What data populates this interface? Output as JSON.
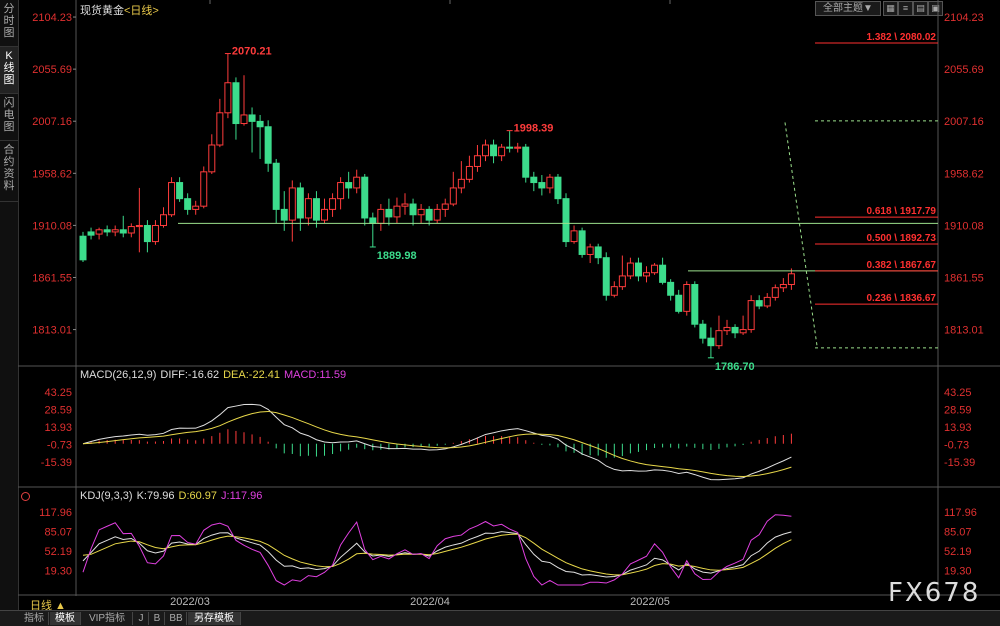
{
  "sidebar": {
    "tabs": [
      {
        "label": "分时图",
        "active": false
      },
      {
        "label": "K线图",
        "active": true
      },
      {
        "label": "闪电图",
        "active": false
      },
      {
        "label": "合约资料",
        "active": false
      }
    ]
  },
  "header": {
    "title": "现货黄金",
    "period": "<日线>",
    "theme_button": "全部主题▼"
  },
  "toolbar_icons": [
    "grid-icon",
    "list-icon",
    "panel-icon",
    "window-icon"
  ],
  "price_axis": {
    "ticks": [
      "2104.23",
      "2055.69",
      "2007.16",
      "1958.62",
      "1910.08",
      "1861.55",
      "1813.01"
    ]
  },
  "annotations": {
    "high1": "2070.21",
    "high2": "1998.39",
    "low1": "1889.98",
    "low2": "1786.70"
  },
  "fib_levels": [
    {
      "label": "1.382 \\ 2080.02",
      "price": 2080.02
    },
    {
      "label": "0.618 \\ 1917.79",
      "price": 1917.79
    },
    {
      "label": "0.500 \\ 1892.73",
      "price": 1892.73
    },
    {
      "label": "0.382 \\ 1867.67",
      "price": 1867.67
    },
    {
      "label": "0.236 \\ 1836.67",
      "price": 1836.67
    }
  ],
  "macd": {
    "name": "MACD(26,12,9)",
    "diff": "DIFF:-16.62",
    "dea": "DEA:-22.41",
    "macd": "MACD:11.59",
    "ticks": [
      "43.25",
      "28.59",
      "13.93",
      "-0.73",
      "-15.39"
    ],
    "ylim": [
      -22,
      50
    ]
  },
  "kdj": {
    "name": "KDJ(9,3,3)",
    "k": "K:79.96",
    "d": "D:60.97",
    "j": "J:117.96",
    "ticks": [
      "117.96",
      "85.07",
      "52.19",
      "19.30"
    ],
    "ylim": [
      -5,
      130
    ]
  },
  "time_axis": {
    "labels": [
      "2022/03",
      "2022/04",
      "2022/05"
    ]
  },
  "period_selector": "日线 ▲",
  "bottom_tabs": [
    {
      "label": "指标",
      "active": false
    },
    {
      "label": "模板",
      "active": true
    },
    {
      "label": "VIP指标",
      "active": false
    },
    {
      "label": "J",
      "active": false
    },
    {
      "label": "B",
      "active": false
    },
    {
      "label": "BB",
      "active": false
    },
    {
      "label": "另存模板",
      "active": true
    }
  ],
  "watermark": "FX678",
  "colors": {
    "up": "#ff3c3c",
    "down": "#3cdc8c",
    "fib": "#ff3030",
    "support": "#9be08c",
    "diff": "#e0e0e0",
    "dea": "#e8d84a",
    "j": "#e040e0"
  },
  "chart_data": {
    "type": "candlestick",
    "ylim": [
      1780,
      2108
    ],
    "candles": [
      [
        1900,
        1878,
        1904,
        1876
      ],
      [
        1904,
        1901,
        1908,
        1897
      ],
      [
        1902,
        1906,
        1908,
        1897
      ],
      [
        1906,
        1904,
        1910,
        1900
      ],
      [
        1904,
        1906,
        1910,
        1900
      ],
      [
        1906,
        1903,
        1919,
        1899
      ],
      [
        1903,
        1909,
        1912,
        1899
      ],
      [
        1909,
        1910,
        1945,
        1885
      ],
      [
        1910,
        1895,
        1915,
        1885
      ],
      [
        1895,
        1910,
        1915,
        1892
      ],
      [
        1910,
        1920,
        1927,
        1908
      ],
      [
        1920,
        1950,
        1955,
        1918
      ],
      [
        1950,
        1935,
        1955,
        1932
      ],
      [
        1935,
        1925,
        1940,
        1920
      ],
      [
        1925,
        1928,
        1933,
        1920
      ],
      [
        1928,
        1960,
        1965,
        1926
      ],
      [
        1960,
        1985,
        1995,
        1958
      ],
      [
        1985,
        2015,
        2028,
        1983
      ],
      [
        2015,
        2043,
        2070,
        2010
      ],
      [
        2043,
        2005,
        2048,
        1990
      ],
      [
        2005,
        2013,
        2050,
        2003
      ],
      [
        2013,
        2007,
        2020,
        1978
      ],
      [
        2007,
        2002,
        2013,
        1972
      ],
      [
        2002,
        1968,
        2008,
        1960
      ],
      [
        1968,
        1925,
        1972,
        1912
      ],
      [
        1925,
        1915,
        1942,
        1905
      ],
      [
        1915,
        1945,
        1952,
        1895
      ],
      [
        1945,
        1917,
        1950,
        1905
      ],
      [
        1917,
        1935,
        1940,
        1910
      ],
      [
        1935,
        1915,
        1942,
        1908
      ],
      [
        1915,
        1925,
        1935,
        1912
      ],
      [
        1925,
        1935,
        1940,
        1918
      ],
      [
        1935,
        1950,
        1955,
        1925
      ],
      [
        1950,
        1945,
        1960,
        1935
      ],
      [
        1945,
        1955,
        1962,
        1940
      ],
      [
        1955,
        1917,
        1958,
        1910
      ],
      [
        1917,
        1912,
        1922,
        1890
      ],
      [
        1912,
        1925,
        1930,
        1905
      ],
      [
        1925,
        1918,
        1935,
        1910
      ],
      [
        1918,
        1928,
        1936,
        1912
      ],
      [
        1928,
        1930,
        1940,
        1920
      ],
      [
        1930,
        1920,
        1935,
        1910
      ],
      [
        1920,
        1925,
        1930,
        1912
      ],
      [
        1925,
        1915,
        1928,
        1910
      ],
      [
        1915,
        1925,
        1930,
        1912
      ],
      [
        1925,
        1930,
        1935,
        1918
      ],
      [
        1930,
        1945,
        1960,
        1928
      ],
      [
        1945,
        1953,
        1970,
        1940
      ],
      [
        1953,
        1965,
        1975,
        1950
      ],
      [
        1965,
        1975,
        1985,
        1960
      ],
      [
        1975,
        1985,
        1990,
        1970
      ],
      [
        1985,
        1975,
        1990,
        1968
      ],
      [
        1975,
        1983,
        1986,
        1970
      ],
      [
        1983,
        1982,
        1998,
        1978
      ],
      [
        1982,
        1983,
        1987,
        1978
      ],
      [
        1983,
        1955,
        1986,
        1950
      ],
      [
        1955,
        1950,
        1960,
        1942
      ],
      [
        1950,
        1945,
        1957,
        1938
      ],
      [
        1945,
        1955,
        1958,
        1940
      ],
      [
        1955,
        1935,
        1958,
        1930
      ],
      [
        1935,
        1895,
        1940,
        1890
      ],
      [
        1895,
        1905,
        1910,
        1893
      ],
      [
        1905,
        1883,
        1908,
        1880
      ],
      [
        1883,
        1890,
        1893,
        1875
      ],
      [
        1890,
        1880,
        1893,
        1874
      ],
      [
        1880,
        1845,
        1885,
        1840
      ],
      [
        1845,
        1853,
        1858,
        1843
      ],
      [
        1853,
        1863,
        1882,
        1850
      ],
      [
        1863,
        1875,
        1880,
        1860
      ],
      [
        1875,
        1863,
        1880,
        1858
      ],
      [
        1863,
        1866,
        1872,
        1857
      ],
      [
        1866,
        1873,
        1875,
        1864
      ],
      [
        1873,
        1857,
        1880,
        1855
      ],
      [
        1857,
        1845,
        1860,
        1840
      ],
      [
        1845,
        1830,
        1850,
        1828
      ],
      [
        1830,
        1855,
        1858,
        1826
      ],
      [
        1855,
        1818,
        1858,
        1815
      ],
      [
        1818,
        1805,
        1822,
        1800
      ],
      [
        1805,
        1798,
        1815,
        1787
      ],
      [
        1798,
        1812,
        1826,
        1795
      ],
      [
        1812,
        1815,
        1822,
        1808
      ],
      [
        1815,
        1810,
        1818,
        1805
      ],
      [
        1810,
        1813,
        1826,
        1808
      ],
      [
        1813,
        1840,
        1845,
        1810
      ],
      [
        1840,
        1835,
        1845,
        1832
      ],
      [
        1835,
        1843,
        1847,
        1833
      ],
      [
        1843,
        1852,
        1855,
        1840
      ],
      [
        1852,
        1855,
        1861,
        1848
      ],
      [
        1855,
        1865,
        1870,
        1850
      ]
    ]
  }
}
